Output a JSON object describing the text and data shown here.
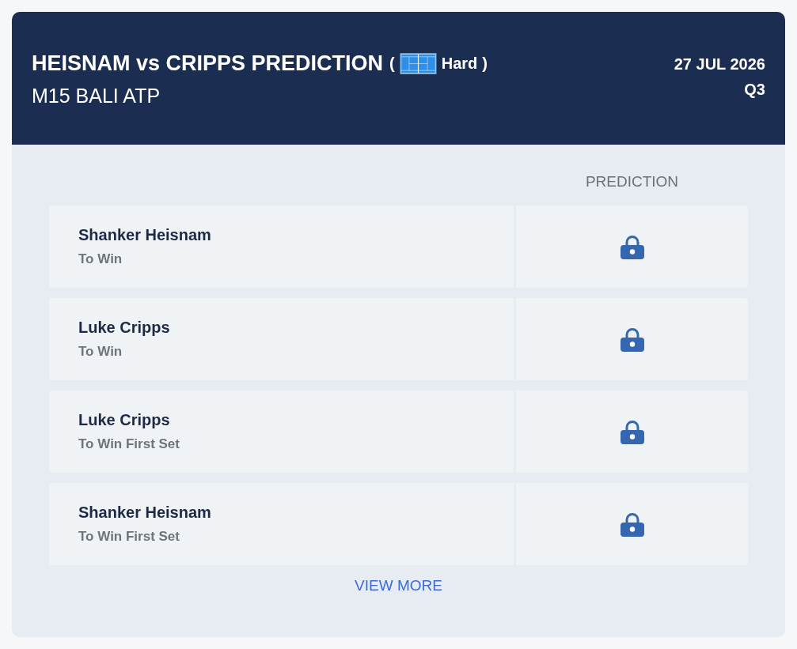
{
  "header": {
    "title": "HEISNAM vs CRIPPS PREDICTION",
    "surface": {
      "open": "(",
      "label": "Hard",
      "close": ")"
    },
    "tournament": "M15 BALI ATP",
    "date": "27 JUL 2026",
    "round": "Q3"
  },
  "table": {
    "column_heading": "PREDICTION",
    "rows": [
      {
        "player": "Shanker Heisnam",
        "market": "To Win",
        "locked": true
      },
      {
        "player": "Luke Cripps",
        "market": "To Win",
        "locked": true
      },
      {
        "player": "Luke Cripps",
        "market": "To Win First Set",
        "locked": true
      },
      {
        "player": "Shanker Heisnam",
        "market": "To Win First Set",
        "locked": true
      }
    ]
  },
  "view_more": "VIEW MORE"
}
